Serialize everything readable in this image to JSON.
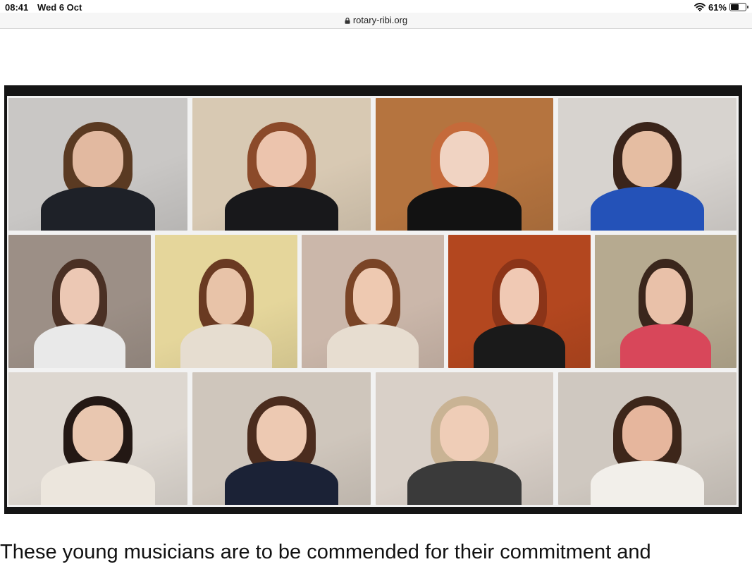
{
  "status_bar": {
    "time": "08:41",
    "date": "Wed 6 Oct",
    "battery_percent": "61%",
    "battery_level": 0.61,
    "wifi_icon": "wifi-icon",
    "battery_icon": "battery-icon"
  },
  "address_bar": {
    "url": "rotary-ribi.org",
    "lock_icon": "lock-icon"
  },
  "video_grid": {
    "participants": [
      {
        "bg": "#c9c7c5",
        "hair": "#5a3a22",
        "skin": "#e2b9a0",
        "top": "#1e2128"
      },
      {
        "bg": "#d8c9b3",
        "hair": "#8b4a2a",
        "skin": "#ecc4ad",
        "top": "#18181b"
      },
      {
        "bg": "#b5743f",
        "hair": "#c56a3a",
        "skin": "#f0d3c2",
        "top": "#121212"
      },
      {
        "bg": "#d7d3cf",
        "hair": "#3a241a",
        "skin": "#e5bda2",
        "top": "#2452b8"
      },
      {
        "bg": "#9c8f86",
        "hair": "#4a3024",
        "skin": "#ecc8b4",
        "top": "#e9e9e9"
      },
      {
        "bg": "#e5d69b",
        "hair": "#6a3a22",
        "skin": "#e8c3a8",
        "top": "#e6ddd0"
      },
      {
        "bg": "#cbb7aa",
        "hair": "#7a4426",
        "skin": "#eec9b1",
        "top": "#e7ddd0"
      },
      {
        "bg": "#b3471f",
        "hair": "#8b3418",
        "skin": "#f0c9b4",
        "top": "#1a1a1a"
      },
      {
        "bg": "#b6aa90",
        "hair": "#3a261c",
        "skin": "#e9c1a9",
        "top": "#d8475a"
      },
      {
        "bg": "#ddd7d0",
        "hair": "#231814",
        "skin": "#e9c7b0",
        "top": "#ece6dd"
      },
      {
        "bg": "#cfc6bc",
        "hair": "#4b2c1e",
        "skin": "#edc9b2",
        "top": "#1b2236"
      },
      {
        "bg": "#d9d0c8",
        "hair": "#c9b394",
        "skin": "#efcdb7",
        "top": "#3a3a3a"
      },
      {
        "bg": "#cfc8c0",
        "hair": "#3d261a",
        "skin": "#e6b69d",
        "top": "#f2efea"
      }
    ]
  },
  "article": {
    "caption": "These young musicians are to be commended for their commitment and"
  }
}
